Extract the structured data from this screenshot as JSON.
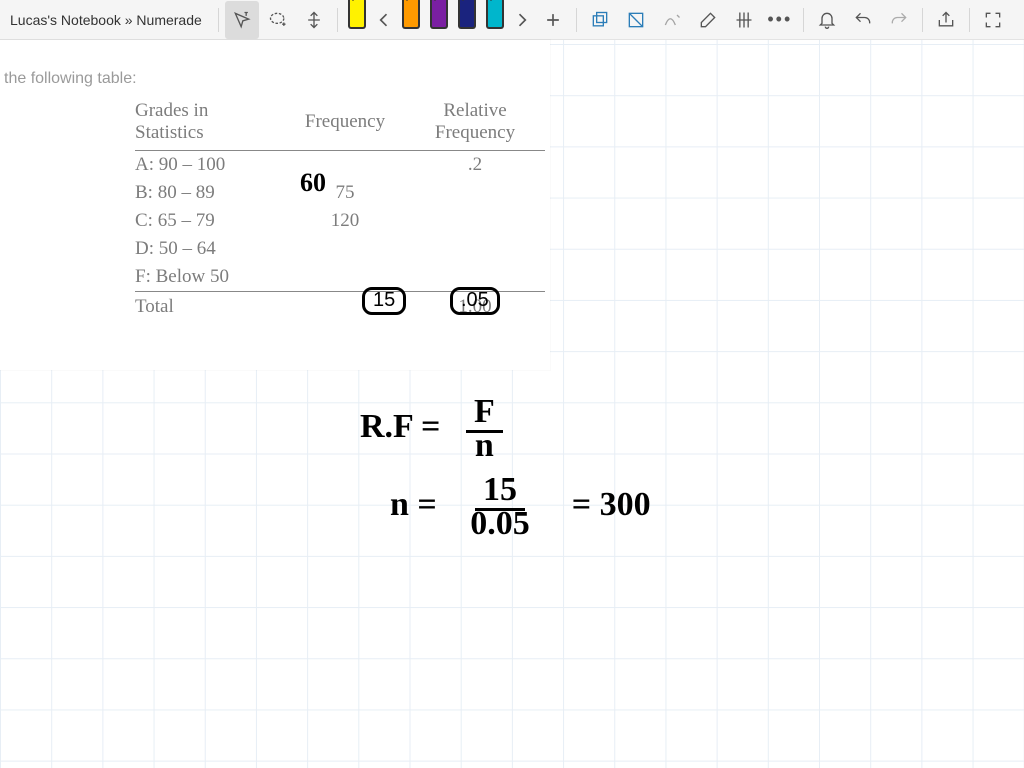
{
  "title": "Lucas's Notebook » Numerade",
  "toolbar_icons": {
    "cursor": "cursor-text-icon",
    "lasso": "lasso-add-icon",
    "panv": "pan-vertical-icon",
    "prev": "chevron-left-icon",
    "next": "chevron-right-icon",
    "add": "plus-icon",
    "shape1": "rect-stack-icon",
    "shape2": "note-icon",
    "ink": "ink-recognize-icon",
    "eraser": "eraser-icon",
    "ruler": "ruler-grid-icon",
    "more": "more-icon",
    "bell": "bell-icon",
    "undo": "undo-icon",
    "redo": "redo-icon",
    "share": "share-icon",
    "full": "fullscreen-icon"
  },
  "markers": [
    "yellow",
    "orange",
    "purple",
    "navy",
    "cyan"
  ],
  "prompt": "the following table:",
  "table": {
    "headers": {
      "c1a": "Grades in",
      "c1b": "Statistics",
      "c2": "Frequency",
      "c3a": "Relative",
      "c3b": "Frequency"
    },
    "rows": [
      {
        "grade": "A: 90 – 100",
        "freq": "",
        "rel": ".2"
      },
      {
        "grade": "B: 80 – 89",
        "freq": "75",
        "rel": ""
      },
      {
        "grade": "C: 65 – 79",
        "freq": "120",
        "rel": ""
      },
      {
        "grade": "D: 50 – 64",
        "freq": "",
        "rel": ""
      },
      {
        "grade": "F: Below 50",
        "freq": "",
        "rel": ""
      }
    ],
    "footer": {
      "label": "Total",
      "freq": "",
      "rel": "1.00"
    }
  },
  "annotations": {
    "freq_a": "60",
    "circled_freq_f": "15",
    "circled_rel_f": ".05"
  },
  "work": {
    "line1_lhs": "R.F =",
    "line1_num": "F",
    "line1_den": "n",
    "line2_lhs": "n =",
    "line2_num": "15",
    "line2_den": "0.05",
    "line2_rhs": "= 300"
  }
}
